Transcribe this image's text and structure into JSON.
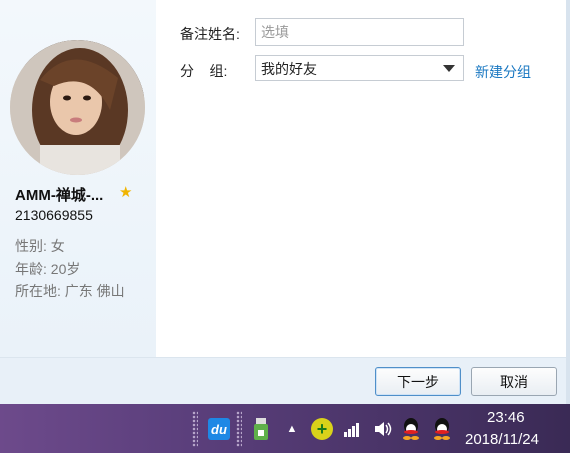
{
  "profile": {
    "nickname": "AMM-禅城-...",
    "qq_number": "2130669855",
    "gender_label": "性别:",
    "gender_value": "女",
    "age_label": "年龄:",
    "age_value": "20岁",
    "location_label": "所在地:",
    "location_value": "广东  佛山"
  },
  "form": {
    "remark_label": "备注姓名:",
    "remark_placeholder": "选填",
    "group_label": "分    组:",
    "group_value": "我的好友",
    "new_group_link": "新建分组"
  },
  "buttons": {
    "next": "下一步",
    "cancel": "取消"
  },
  "taskbar": {
    "time": "23:46",
    "date": "2018/11/24",
    "baidu_icon_text": "du",
    "icons": [
      "baidu-disk-icon",
      "usb-icon",
      "show-hidden-icons-chevron",
      "360-plus-icon",
      "network-signal-icon",
      "volume-icon",
      "qq-icon",
      "qq-icon"
    ]
  },
  "colors": {
    "link": "#1a78c2",
    "star": "#f0b400",
    "footer": "#e8f0f8",
    "taskbar": "#5b3f7c"
  }
}
